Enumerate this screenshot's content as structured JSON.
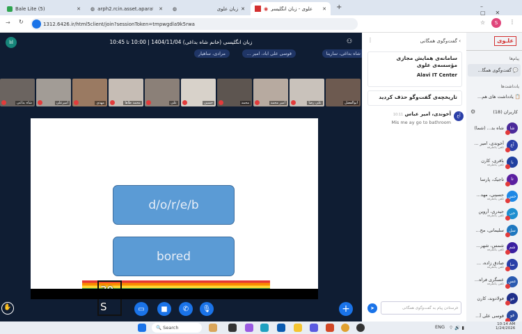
{
  "browser": {
    "tabs": [
      {
        "label": "Bale Lite (5)"
      },
      {
        "label": "arph2.rcin.asset.aparat.com/a"
      },
      {
        "label": ""
      },
      {
        "label": "زبان علوی"
      },
      {
        "label": "علوی - زبان انگلیسی (خانم شا"
      }
    ],
    "url": "1312.6426.ir/html5client/join?sessionToken=tmpwgdla9k5rwa"
  },
  "meeting": {
    "title": "زبان انگلیسی (خانم شاه بداغی) 1404/11/04 | 10:00 تا 10:45",
    "chips": [
      "شاه بداغی، سارینا",
      "قوسی علی اباد، امیر ...",
      "مرادی، ساهیار"
    ],
    "videos": [
      "ابوالفضل",
      "علی رضا",
      "امیر محمد",
      "محمد",
      "حسین",
      "علی",
      "محمد طاها",
      "مهدی",
      "امیرعلی",
      "شاه بداغی"
    ],
    "slide": {
      "box1": "d/o/r/e/b",
      "box2": "bored",
      "annotation1": "30",
      "annotation2": "S"
    }
  },
  "chat": {
    "header": "گفت‌وگوی همگانی",
    "welcome_title": "سامانه‌ی همایش مجازی مؤسسه‌ی علوی",
    "welcome_sub": "Alavi IT Center",
    "cleared": "تاریخچه‌ی گفت‌وگو حذف کردید",
    "message": {
      "sender": "آخوندی، امیر عباس",
      "time": "10:11",
      "initials": "آع",
      "text": "Mis me ay go to bathroom"
    },
    "input_placeholder": "فرستادن پیام به گفت‌وگوی همگانی"
  },
  "sidebar": {
    "logo": "علـوی",
    "messages_label": "پیام‌ها",
    "public_chat": "گفت‌وگوی همگا...",
    "notes_label": "یادداشت‌ها",
    "shared_notes": "یادداشت های هم...",
    "users_label": "کاربران (18)",
    "status": "تلفن یکطرفه",
    "users": [
      {
        "name": "شاه بد... (شما)",
        "ini": "شا",
        "color": "#4b2a9a",
        "sub": ""
      },
      {
        "name": "آخوندی، امیر ...",
        "ini": "آع",
        "color": "#2b3fa8",
        "sub": "تلفن یکطرفه"
      },
      {
        "name": "باقری، کارن",
        "ini": "با",
        "color": "#1f3fa0",
        "sub": "تلفن یکطرفه"
      },
      {
        "name": "تاجیک، پارسا",
        "ini": "تا",
        "color": "#5a1fa0",
        "sub": ""
      },
      {
        "name": "حسینی، مهد...",
        "ini": "حس",
        "color": "#1e88e5",
        "sub": "تلفن یکطرفه"
      },
      {
        "name": "حیدری، آروین",
        "ini": "حی",
        "color": "#1e8fd0",
        "sub": "تلفن یکطرفه"
      },
      {
        "name": "سلیمانی، مح...",
        "ini": "سل",
        "color": "#1f78c0",
        "sub": ""
      },
      {
        "name": "شمس، شهر...",
        "ini": "شم",
        "color": "#3a1fa0",
        "sub": "تلفن یکطرفه"
      },
      {
        "name": "صادق زاده، ...",
        "ini": "صا",
        "color": "#2a3fa8",
        "sub": "تلفن یکطرفه"
      },
      {
        "name": "عسگری فراه...",
        "ini": "عس",
        "color": "#2a5ab0",
        "sub": "تلفن یکطرفه"
      },
      {
        "name": "فولادوند، کارن",
        "ini": "فو",
        "color": "#1f2f8a",
        "sub": ""
      },
      {
        "name": "قوسی علی آ...",
        "ini": "قو",
        "color": "#2a4aa0",
        "sub": ""
      }
    ]
  },
  "taskbar": {
    "search": "Search",
    "lang": "ENG",
    "time": "10:14 AM",
    "date": "1/24/2026"
  }
}
